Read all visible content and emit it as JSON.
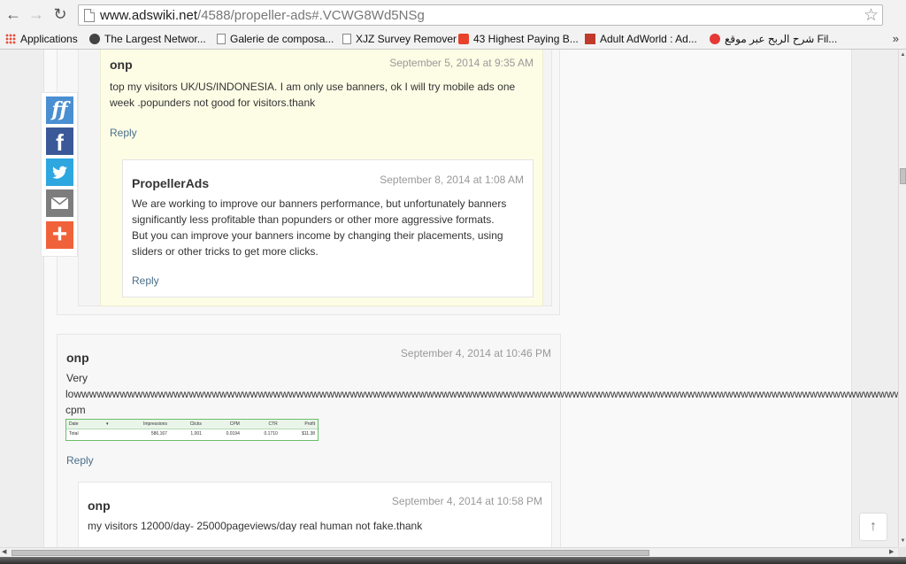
{
  "browser": {
    "url_host": "www.adswiki.net",
    "url_path": "/4588/propeller-ads#.VCWG8Wd5NSg",
    "bookmarks": [
      {
        "label": "Applications",
        "icon": "apps-grid-icon"
      },
      {
        "label": "The Largest Networ...",
        "icon": "site-icon"
      },
      {
        "label": "Galerie de composa...",
        "icon": "page-icon"
      },
      {
        "label": "XJZ Survey Remover",
        "icon": "page-icon"
      },
      {
        "label": "43 Highest Paying B...",
        "icon": "blogger-icon"
      },
      {
        "label": "Adult AdWorld : Ad...",
        "icon": "adworld-icon"
      },
      {
        "label": "شرح الربح عبر موقع Fil...",
        "icon": "red-circle-icon"
      }
    ],
    "more": "»"
  },
  "share": [
    "ff",
    "f"
  ],
  "comments": {
    "c1": {
      "author": "onp",
      "date": "September 5, 2014 at 9:35 AM",
      "text": "top my visitors UK/US/INDONESIA. I am only use banners, ok I will try mobile ads one week .popunders not good for visitors.thank",
      "reply": "Reply"
    },
    "c1r": {
      "author": "PropellerAds",
      "date": "September 8, 2014 at 1:08 AM",
      "p1": "We are working to improve our banners performance, but unfortunately banners significantly less profitable than popunders or other more aggressive formats.",
      "p2": "But you can improve your banners income by changing their placements, using sliders or other tricks to get more clicks.",
      "reply": "Reply"
    },
    "c2": {
      "author": "onp",
      "date": "September 4, 2014 at 10:46 PM",
      "text1": "Very",
      "text2": "lowwwwwwwwwwwwwwwwwwwwwwwwwwwwwwwwwwwwwwwwwwwwwwwwwwwwwwwwwwwwwwwwwwwwwwwwwwwwwwwwwwwwwwwwwwwwwwwwwwwwwwwwwwwwwwwwwwwwwwwwwwwwwwwwwwwww",
      "text3": "cpm",
      "reply": "Reply"
    },
    "c3": {
      "author": "onp",
      "date": "September 4, 2014 at 10:58 PM",
      "text": "my visitors 12000/day- 25000pageviews/day real human not fake.thank"
    }
  },
  "stats_table": {
    "headers": [
      "Date",
      "▾",
      "Impressions",
      "Clicks",
      "CPM",
      "CTR",
      "Profit"
    ],
    "row": [
      "Total",
      "",
      "586,167",
      "1,001",
      "0.0194",
      "0.1710",
      "$11.38"
    ]
  },
  "to_top": "↑"
}
